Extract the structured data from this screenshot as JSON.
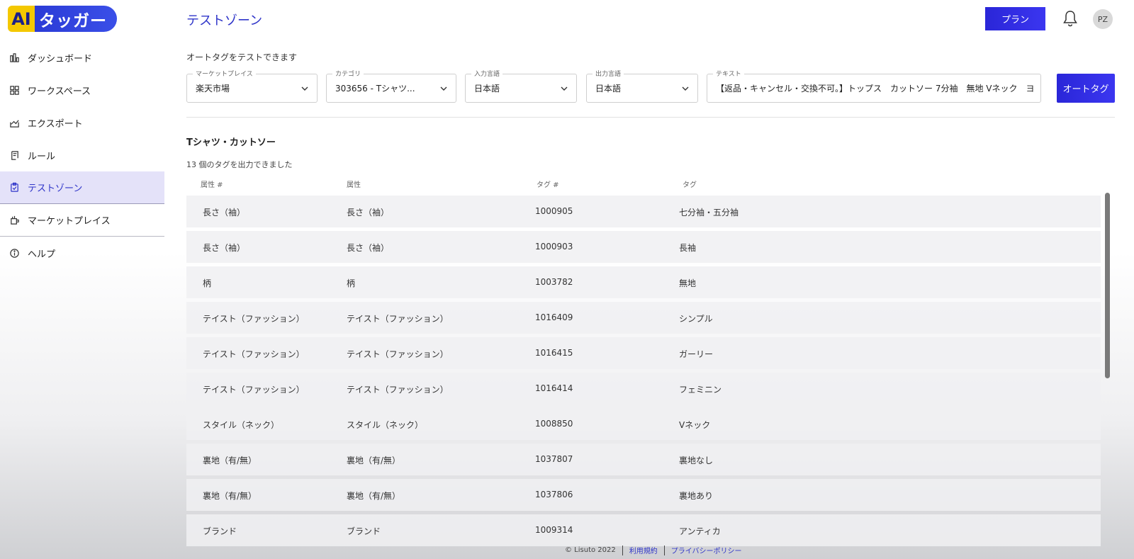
{
  "logo": {
    "ai": "AI",
    "text": "タッガー"
  },
  "sidebar": {
    "items": [
      {
        "label": "ダッシュボード",
        "icon": "bar-chart-icon"
      },
      {
        "label": "ワークスペース",
        "icon": "grid-icon"
      },
      {
        "label": "エクスポート",
        "icon": "export-icon"
      },
      {
        "label": "ルール",
        "icon": "document-icon"
      },
      {
        "label": "テストゾーン",
        "icon": "clipboard-check-icon",
        "active": true
      },
      {
        "label": "マーケットプレイス",
        "icon": "store-icon"
      },
      {
        "label": "ヘルプ",
        "icon": "info-icon"
      }
    ]
  },
  "header": {
    "title": "テストゾーン",
    "plan_label": "プラン",
    "avatar_initials": "PZ"
  },
  "form": {
    "subtitle": "オートタグをテストできます",
    "marketplace": {
      "label": "マーケットプレイス",
      "value": "楽天市場"
    },
    "category": {
      "label": "カテゴリ",
      "value": "303656 - Tシャツ..."
    },
    "input_lang": {
      "label": "入力言語",
      "value": "日本語"
    },
    "output_lang": {
      "label": "出力言語",
      "value": "日本語"
    },
    "text": {
      "label": "テキスト",
      "value": "【返品・キャンセル・交換不可。】トップス　カットソー 7分袖　無地 Vネック　ヨ..."
    },
    "autotag_label": "オートタグ"
  },
  "results": {
    "section_title": "Tシャツ・カットソー",
    "count_text": "13 個のタグを出力できました",
    "columns": [
      "属性 #",
      "属性",
      "タグ #",
      "タグ"
    ],
    "rows": [
      [
        "長さ（袖）",
        "長さ（袖）",
        "1000905",
        "七分袖・五分袖"
      ],
      [
        "長さ（袖）",
        "長さ（袖）",
        "1000903",
        "長袖"
      ],
      [
        "柄",
        "柄",
        "1003782",
        "無地"
      ],
      [
        "テイスト（ファッション）",
        "テイスト（ファッション）",
        "1016409",
        "シンプル"
      ],
      [
        "テイスト（ファッション）",
        "テイスト（ファッション）",
        "1016415",
        "ガーリー"
      ],
      [
        "テイスト（ファッション）",
        "テイスト（ファッション）",
        "1016414",
        "フェミニン"
      ],
      [
        "スタイル（ネック）",
        "スタイル（ネック）",
        "1008850",
        "Vネック"
      ],
      [
        "裏地（有/無）",
        "裏地（有/無）",
        "1037807",
        "裏地なし"
      ],
      [
        "裏地（有/無）",
        "裏地（有/無）",
        "1037806",
        "裏地あり"
      ],
      [
        "ブランド",
        "ブランド",
        "1009314",
        "アンティカ"
      ]
    ]
  },
  "footer": {
    "copyright": "© Lisuto 2022",
    "terms": "利用規約",
    "privacy": "プライバシーポリシー"
  },
  "colors": {
    "accent": "#2f35c9",
    "button": "#2a26d8",
    "logo_yellow": "#f4c800"
  }
}
